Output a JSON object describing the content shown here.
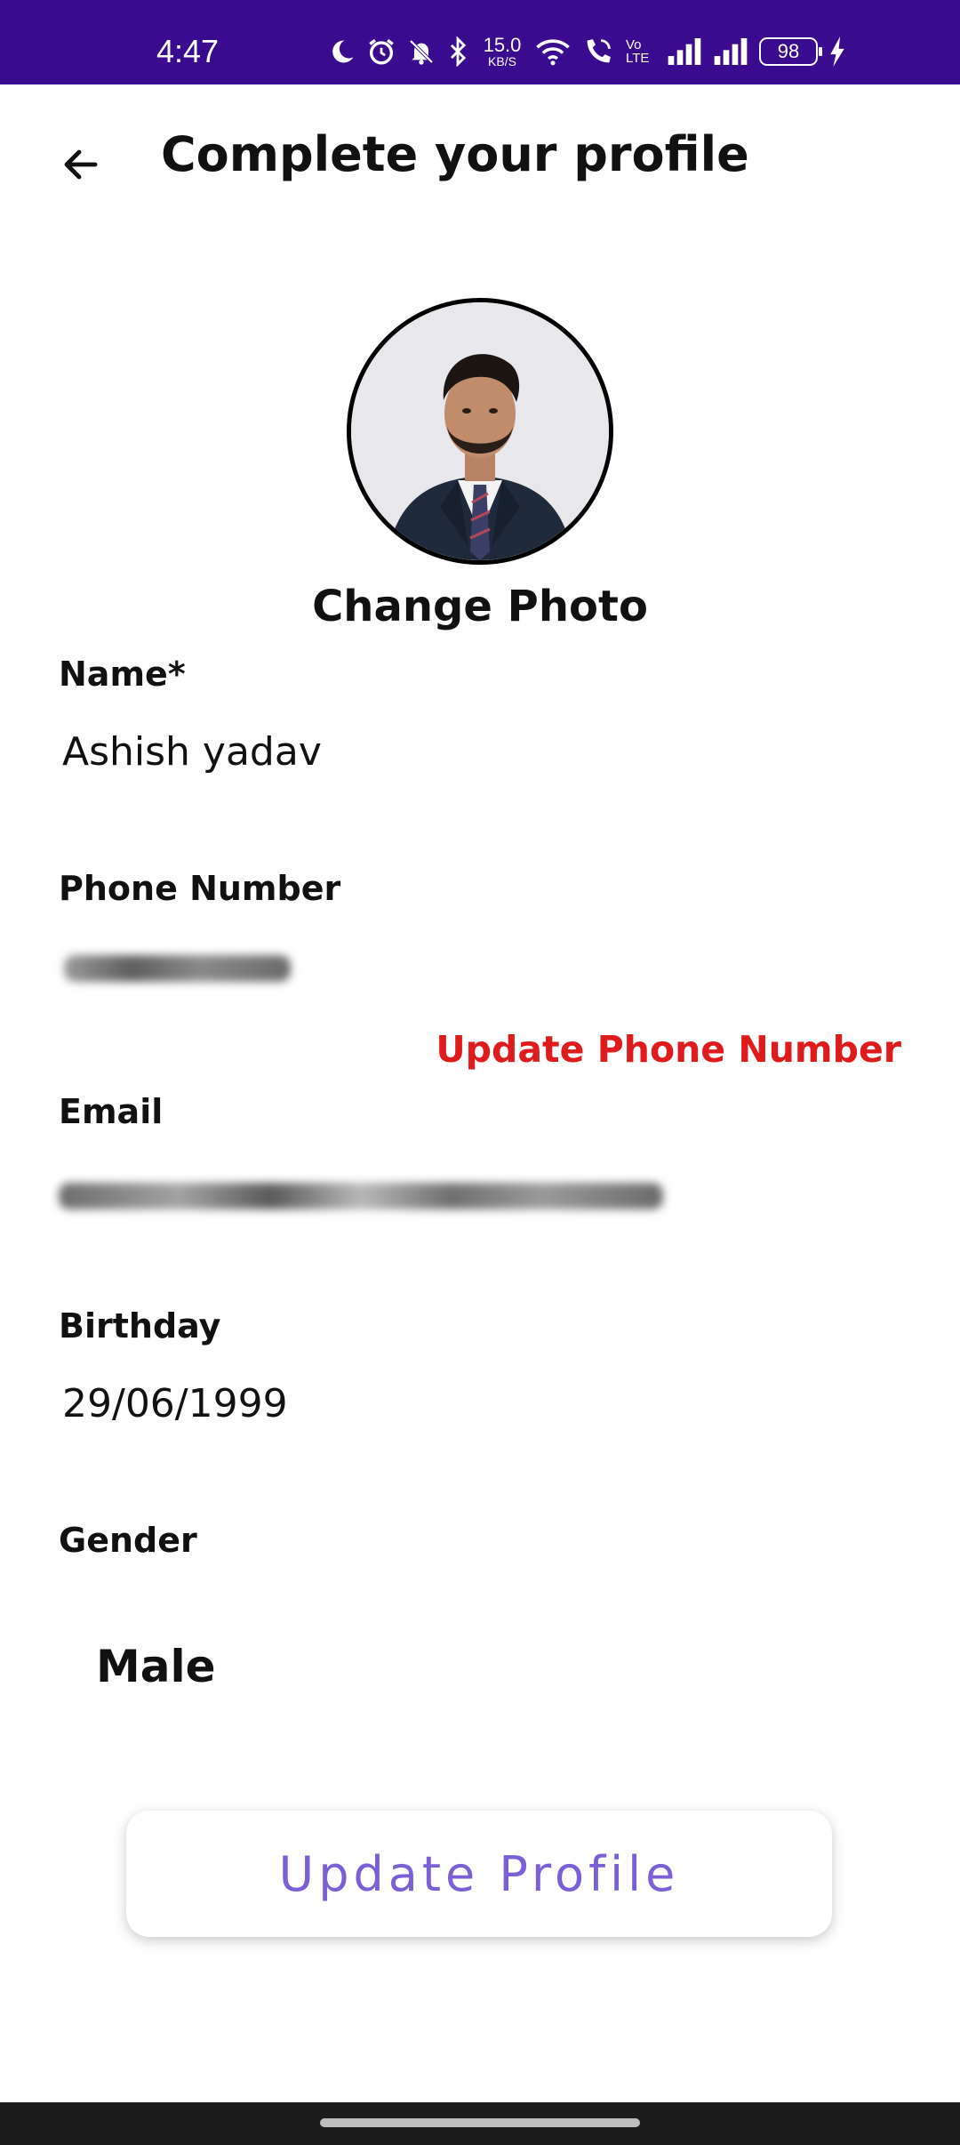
{
  "status_bar": {
    "time": "4:47",
    "net_speed_value": "15.0",
    "net_speed_unit": "KB/S",
    "volte": "Vo LTE",
    "battery": "98",
    "background_color": "#3a0a8f"
  },
  "header": {
    "title": "Complete your profile",
    "back_icon": "arrow-left-icon"
  },
  "profile": {
    "change_photo_label": "Change Photo"
  },
  "form": {
    "name_label": "Name*",
    "name_value": "Ashish yadav",
    "phone_label": "Phone Number",
    "update_phone_label": "Update Phone Number",
    "email_label": "Email",
    "birthday_label": "Birthday",
    "birthday_value": "29/06/1999",
    "gender_label": "Gender",
    "gender_value": "Male"
  },
  "actions": {
    "update_profile_label": "Update Profile"
  },
  "colors": {
    "accent": "#7a5fd6",
    "warning": "#e01b1b",
    "status_bar": "#3a0a8f"
  }
}
